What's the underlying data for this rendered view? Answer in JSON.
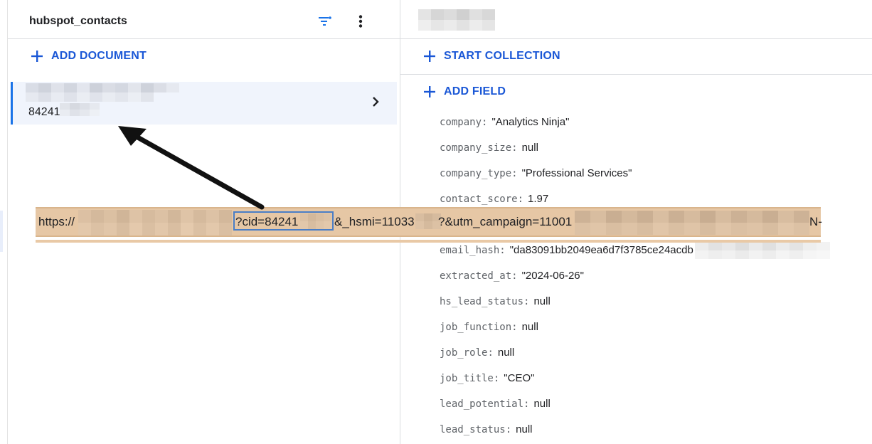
{
  "collection": {
    "title": "hubspot_contacts",
    "icons": {
      "filter": "filter-list-icon",
      "menu": "more-vert-icon"
    }
  },
  "left": {
    "add_document_label": "ADD DOCUMENT",
    "document": {
      "id_prefix": "84241",
      "chevron": "chevron-right-icon"
    }
  },
  "right": {
    "start_collection_label": "START COLLECTION",
    "add_field_label": "ADD FIELD",
    "fields": [
      {
        "key": "company",
        "value": "\"Analytics Ninja\""
      },
      {
        "key": "company_size",
        "value": "null"
      },
      {
        "key": "company_type",
        "value": "\"Professional Services\""
      },
      {
        "key": "contact_score",
        "value": "1.97"
      },
      {
        "key": "",
        "value": ""
      },
      {
        "key": "email_hash",
        "value": "\"da83091bb2049ea6d7f3785ce24acdb"
      },
      {
        "key": "extracted_at",
        "value": "\"2024-06-26\""
      },
      {
        "key": "hs_lead_status",
        "value": "null"
      },
      {
        "key": "job_function",
        "value": "null"
      },
      {
        "key": "job_role",
        "value": "null"
      },
      {
        "key": "job_title",
        "value": "\"CEO\""
      },
      {
        "key": "lead_potential",
        "value": "null"
      },
      {
        "key": "lead_status",
        "value": "null"
      }
    ]
  },
  "url_overlay": {
    "scheme": "https://",
    "cid_part": "?cid=84241",
    "hsmi_part": "&_hsmi=11033",
    "campaign_part": "?&utm_campaign=11001",
    "tail": "N-"
  },
  "colors": {
    "accent": "#1a57d6",
    "selected_row": "#f0f4fc",
    "url_highlight": "#e6c7a5",
    "cid_box": "#4a7ec7"
  }
}
